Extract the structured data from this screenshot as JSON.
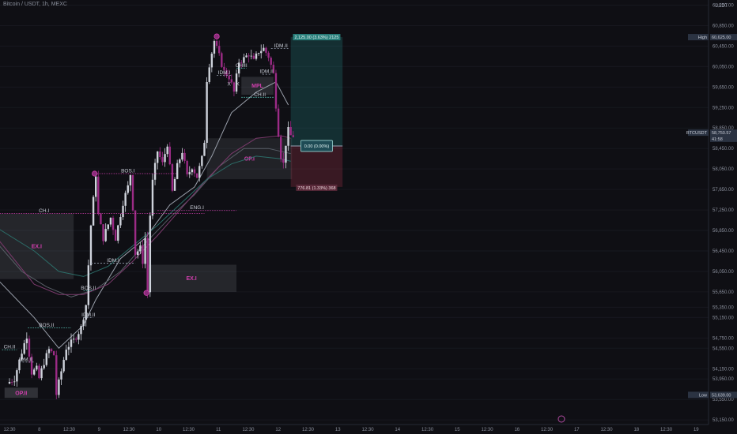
{
  "header": {
    "title": "Bitcoin / USDT, 1h, MEXC"
  },
  "chart_data": {
    "type": "candlestick",
    "title": "Bitcoin / USDT, 1h, MEXC",
    "currency_label": "USDT",
    "ylim": [
      53060,
      61350
    ],
    "y_ticks": [
      {
        "v": 61250,
        "t": "61,250.00"
      },
      {
        "v": 60850,
        "t": "60,850.00"
      },
      {
        "v": 60450,
        "t": "60,450.00"
      },
      {
        "v": 60050,
        "t": "60,050.00"
      },
      {
        "v": 59650,
        "t": "59,650.00"
      },
      {
        "v": 59250,
        "t": "59,250.00"
      },
      {
        "v": 58850,
        "t": "58,850.00"
      },
      {
        "v": 58450,
        "t": "58,450.00"
      },
      {
        "v": 58050,
        "t": "58,050.00"
      },
      {
        "v": 57650,
        "t": "57,650.00"
      },
      {
        "v": 57250,
        "t": "57,250.00"
      },
      {
        "v": 56850,
        "t": "56,850.00"
      },
      {
        "v": 56450,
        "t": "56,450.00"
      },
      {
        "v": 56050,
        "t": "56,050.00"
      },
      {
        "v": 55650,
        "t": "55,650.00"
      },
      {
        "v": 55350,
        "t": "55,350.00"
      },
      {
        "v": 55150,
        "t": "55,150.00"
      },
      {
        "v": 54750,
        "t": "54,750.00"
      },
      {
        "v": 54550,
        "t": "54,550.00"
      },
      {
        "v": 54150,
        "t": "54,150.00"
      },
      {
        "v": 53950,
        "t": "53,950.00"
      },
      {
        "v": 53550,
        "t": "53,550.00"
      },
      {
        "v": 53150,
        "t": "53,150.00"
      }
    ],
    "x_ticks": [
      "12:30",
      "8",
      "12:30",
      "9",
      "12:30",
      "10",
      "12:30",
      "11",
      "12:30",
      "12",
      "12:30",
      "13",
      "12:30",
      "14",
      "12:30",
      "15",
      "12:30",
      "16",
      "12:30",
      "17",
      "12:30",
      "18",
      "12:30",
      "19"
    ],
    "x_unit": "hours",
    "last_candle_index": 115,
    "price_path": [
      [
        0,
        53860
      ],
      [
        3,
        53960
      ],
      [
        6,
        54480
      ],
      [
        8,
        54800
      ],
      [
        10,
        54080
      ],
      [
        12,
        54140
      ],
      [
        13,
        53960
      ],
      [
        15,
        54280
      ],
      [
        17,
        54520
      ],
      [
        19,
        54420
      ],
      [
        20,
        53650
      ],
      [
        22,
        54100
      ],
      [
        24,
        54560
      ],
      [
        27,
        54700
      ],
      [
        30,
        54950
      ],
      [
        32,
        55400
      ],
      [
        34,
        56950
      ],
      [
        36,
        57950
      ],
      [
        37,
        57150
      ],
      [
        39,
        56700
      ],
      [
        42,
        57100
      ],
      [
        44,
        56700
      ],
      [
        47,
        57400
      ],
      [
        49,
        57700
      ],
      [
        50,
        57950
      ],
      [
        51,
        57300
      ],
      [
        52,
        56400
      ],
      [
        54,
        56500
      ],
      [
        55,
        56250
      ],
      [
        56,
        56700
      ],
      [
        57,
        55650
      ],
      [
        58,
        57150
      ],
      [
        59,
        57800
      ],
      [
        61,
        58400
      ],
      [
        63,
        58150
      ],
      [
        65,
        58550
      ],
      [
        67,
        57600
      ],
      [
        69,
        58100
      ],
      [
        71,
        58400
      ],
      [
        73,
        57900
      ],
      [
        75,
        58100
      ],
      [
        77,
        57900
      ],
      [
        79,
        58250
      ],
      [
        80,
        58600
      ],
      [
        81,
        59800
      ],
      [
        82,
        60100
      ],
      [
        84,
        60550
      ],
      [
        86,
        60250
      ],
      [
        88,
        59950
      ],
      [
        90,
        59850
      ],
      [
        92,
        59550
      ],
      [
        94,
        60150
      ],
      [
        96,
        60200
      ],
      [
        98,
        60300
      ],
      [
        100,
        60150
      ],
      [
        102,
        60350
      ],
      [
        104,
        60400
      ],
      [
        106,
        60250
      ],
      [
        108,
        59900
      ],
      [
        109,
        59300
      ],
      [
        110,
        58750
      ],
      [
        111,
        58300
      ],
      [
        112,
        58150
      ],
      [
        113,
        58550
      ],
      [
        114,
        58800
      ],
      [
        115,
        58700
      ]
    ],
    "zones": [
      {
        "label": "EX.I",
        "x0": -4,
        "x1": 26,
        "y0": 55900,
        "y1": 57180,
        "fill": "#c8ccd6",
        "fill_opacity": 0.12,
        "text_color": "#d23fae"
      },
      {
        "label": "EX.I",
        "x0": 55.5,
        "x1": 92,
        "y0": 55650,
        "y1": 56180,
        "fill": "#c8ccd6",
        "fill_opacity": 0.12,
        "text_color": "#d23fae"
      },
      {
        "label": "OP.I",
        "x0": 80,
        "x1": 114.5,
        "y0": 57850,
        "y1": 58650,
        "fill": "#c8ccd6",
        "fill_opacity": 0.1,
        "text_color": "#d23fae"
      },
      {
        "label": "MPL",
        "x0": 94,
        "x1": 107,
        "y0": 59500,
        "y1": 59850,
        "fill": "#c8ccd6",
        "fill_opacity": 0.14,
        "text_color": "#d23fae"
      },
      {
        "label": "OP.II",
        "x0": -2,
        "x1": 11.5,
        "y0": 53580,
        "y1": 53780,
        "fill": "#c8ccd6",
        "fill_opacity": 0.18,
        "text_color": "#d23fae"
      }
    ],
    "levels": [
      {
        "label": "CH.I",
        "y": 57180,
        "x0": -4,
        "x1": 79,
        "label_x": 14,
        "color": "#d23fae",
        "text_color": "#c8ccd6"
      },
      {
        "label": "BOS.I",
        "y": 57960,
        "x0": 34.5,
        "x1": 68,
        "label_x": 48,
        "color": "#d23fae",
        "text_color": "#c8ccd6"
      },
      {
        "label": "IDM.I",
        "y": 56210,
        "x0": 33,
        "x1": 51,
        "label_x": 42,
        "color": "#9aa4b4",
        "text_color": "#c8ccd6"
      },
      {
        "label": "ENG.I",
        "y": 57240,
        "x0": 60,
        "x1": 92,
        "label_x": 76,
        "color": "#d23fae",
        "text_color": "#c8ccd6"
      },
      {
        "label": "BOS.II",
        "y": 54950,
        "x0": 7.5,
        "x1": 25,
        "label_x": 15,
        "color": "#5fd0c2",
        "text_color": "#c8ccd6"
      },
      {
        "label": "CH.II",
        "y": 54520,
        "x0": -3,
        "x1": 3,
        "label_x": 0,
        "color": "#5fd0c2",
        "text_color": "#c8ccd6"
      },
      {
        "label": "IDM.II",
        "y": 54280,
        "x0": 4,
        "x1": 10,
        "label_x": 6.5,
        "color": "#9aa4b4",
        "text_color": "#c8ccd6"
      },
      {
        "label": "BOS.II",
        "y": 55670,
        "x0": 30,
        "x1": 34,
        "label_x": 32,
        "color": "#5fd0c2",
        "text_color": "#c8ccd6"
      },
      {
        "label": "IDM.II",
        "y": 55150,
        "x0": 30,
        "x1": 34,
        "label_x": 32,
        "color": "#9aa4b4",
        "text_color": "#c8ccd6"
      },
      {
        "label": "IDM.I",
        "y": 59880,
        "x0": 84,
        "x1": 90,
        "label_x": 87,
        "color": "#9aa4b4",
        "text_color": "#c8ccd6"
      },
      {
        "label": "CH.II",
        "y": 60020,
        "x0": 92,
        "x1": 96,
        "label_x": 94,
        "color": "#5fd0c2",
        "text_color": "#c8ccd6"
      },
      {
        "label": "CH.II",
        "y": 59450,
        "x0": 94,
        "x1": 107,
        "label_x": 101.5,
        "color": "#5fd0c2",
        "text_color": "#c8ccd6"
      },
      {
        "label": "IDM.II",
        "y": 60400,
        "x0": 106,
        "x1": 113,
        "label_x": 110,
        "color": "#9aa4b4",
        "text_color": "#c8ccd6"
      },
      {
        "label": "IDM.II",
        "y": 59900,
        "x0": 102.5,
        "x1": 106,
        "label_x": 104.2,
        "color": "#9aa4b4",
        "text_color": "#c8ccd6"
      }
    ],
    "marks": [
      {
        "label": "X",
        "x": 89,
        "y": 59680
      },
      {
        "label": "X",
        "x": 92.5,
        "y": 59680
      }
    ],
    "swing_points": [
      {
        "x": 34.5,
        "y": 57960
      },
      {
        "x": 55.5,
        "y": 55630
      },
      {
        "x": 84,
        "y": 60640
      }
    ],
    "position": {
      "x0": 114,
      "x1": 135,
      "entry": 58500,
      "target": 60625,
      "stop": 57700,
      "target_label": "2,125.00 (3.63%) 2125",
      "stop_label": "776.81 (1.33%) 368",
      "center_label": "0.00 (0.00%)",
      "profit_color": "#2aa6a0",
      "loss_color": "#d23f5a"
    },
    "price_tags": [
      {
        "label": "High",
        "value": "60,625.00",
        "y": 60625,
        "bg": "#2b3342",
        "fg": "#c8ccd6"
      },
      {
        "label": "BTCUSDT",
        "value": "58,750.57",
        "y": 58760,
        "bg": "#2b3342",
        "fg": "#c8ccd6"
      },
      {
        "label": "",
        "value": "41:58",
        "y": 58640,
        "bg": "#2b3342",
        "fg": "#c8ccd6"
      },
      {
        "label": "Low",
        "value": "53,639.00",
        "y": 53639,
        "bg": "#2b3342",
        "fg": "#c8ccd6"
      }
    ],
    "moving_averages": [
      {
        "name": "",
        "color": "#9aa0ab",
        "points": [
          [
            -5,
            55900
          ],
          [
            10,
            55150
          ],
          [
            20,
            54550
          ],
          [
            30,
            55000
          ],
          [
            35,
            55500
          ],
          [
            45,
            56300
          ],
          [
            55,
            56700
          ],
          [
            65,
            57350
          ],
          [
            75,
            57700
          ],
          [
            82,
            58300
          ],
          [
            90,
            59150
          ],
          [
            100,
            59550
          ],
          [
            108,
            59750
          ],
          [
            113,
            59300
          ]
        ]
      },
      {
        "name": "",
        "color": "#5a5f68",
        "points": [
          [
            -5,
            56600
          ],
          [
            5,
            56050
          ],
          [
            15,
            55750
          ],
          [
            25,
            55550
          ],
          [
            35,
            55700
          ],
          [
            45,
            56050
          ],
          [
            55,
            56600
          ],
          [
            65,
            57100
          ],
          [
            75,
            57550
          ],
          [
            85,
            58100
          ],
          [
            95,
            58450
          ],
          [
            105,
            58450
          ],
          [
            114,
            58350
          ]
        ]
      },
      {
        "name": "",
        "color": "#7b3a6c",
        "points": [
          [
            -5,
            56700
          ],
          [
            10,
            55800
          ],
          [
            20,
            55600
          ],
          [
            30,
            55600
          ],
          [
            40,
            55800
          ],
          [
            50,
            56250
          ],
          [
            60,
            56750
          ],
          [
            70,
            57300
          ],
          [
            80,
            57850
          ],
          [
            90,
            58350
          ],
          [
            100,
            58650
          ],
          [
            110,
            58700
          ],
          [
            114,
            58650
          ]
        ]
      },
      {
        "name": "",
        "color": "#2c6d68",
        "points": [
          [
            -5,
            56900
          ],
          [
            10,
            56450
          ],
          [
            20,
            56050
          ],
          [
            30,
            55950
          ],
          [
            40,
            56150
          ],
          [
            50,
            56550
          ],
          [
            60,
            56950
          ],
          [
            70,
            57400
          ],
          [
            80,
            57850
          ],
          [
            90,
            58150
          ],
          [
            100,
            58300
          ],
          [
            110,
            58250
          ],
          [
            114,
            58200
          ]
        ]
      }
    ]
  }
}
